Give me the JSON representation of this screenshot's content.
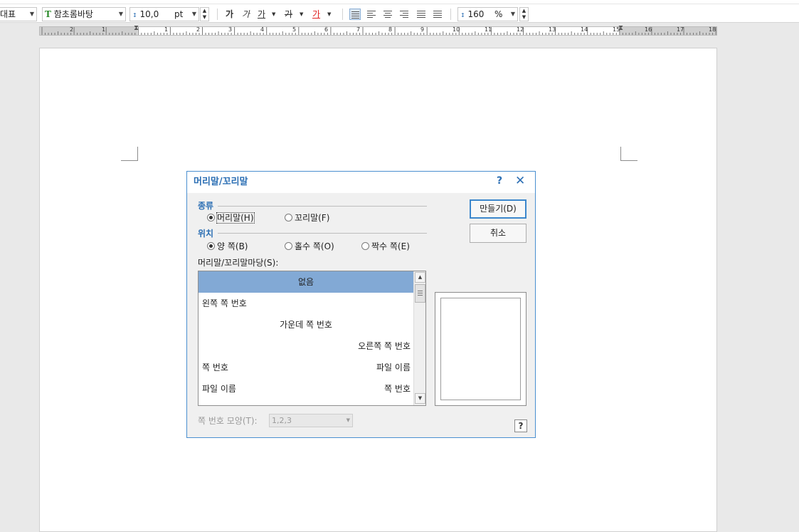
{
  "toolbar": {
    "style_value": "대표",
    "font_icon": "T",
    "font_value": "함초롬바탕",
    "size_value": "10,0",
    "size_unit": "pt",
    "bold_label": "가",
    "italic_label": "가",
    "underline_label": "가",
    "strike_label": "가",
    "color_label": "가",
    "line_spacing_value": "160",
    "line_spacing_unit": "%",
    "text_color": "#e02020",
    "icons": [
      "font-type-icon",
      "font-size-icon",
      "line-spacing-icon",
      "align-justify-icon",
      "align-left-icon",
      "align-center-icon",
      "align-right-icon",
      "distribute-icon",
      "divide-icon"
    ]
  },
  "ruler": {
    "numbers": [
      "2",
      "1",
      "1",
      "2",
      "3",
      "4",
      "5",
      "6",
      "7",
      "8",
      "9",
      "10",
      "11",
      "12",
      "13",
      "14",
      "15",
      "16",
      "17",
      "18"
    ]
  },
  "dialog": {
    "title": "머리말/꼬리말",
    "help_label": "?",
    "close_label": "✕",
    "type_group": {
      "label": "종류",
      "options": [
        "머리말(H)",
        "꼬리말(F)"
      ],
      "selected": 0
    },
    "position_group": {
      "label": "위치",
      "options": [
        "양 쪽(B)",
        "홀수 쪽(O)",
        "짝수 쪽(E)"
      ],
      "selected": 0
    },
    "templates_label": "머리말/꼬리말마당(S):",
    "templates": [
      {
        "left": "",
        "center": "없음",
        "right": ""
      },
      {
        "left": "왼쪽 쪽 번호",
        "center": "",
        "right": ""
      },
      {
        "left": "",
        "center": "가운데 쪽 번호",
        "right": ""
      },
      {
        "left": "",
        "center": "",
        "right": "오른쪽 쪽 번호"
      },
      {
        "left": "쪽 번호",
        "center": "",
        "right": "파일 이름"
      },
      {
        "left": "파일 이름",
        "center": "",
        "right": "쪽 번호"
      }
    ],
    "selected_template": 0,
    "create_button": "만들기(D)",
    "cancel_button": "취소",
    "page_number_format_label": "쪽 번호 모양(T):",
    "page_number_format_value": "1,2,3",
    "help_button": "?",
    "accent_color": "#2c6fb4",
    "selection_color": "#82a9d5"
  }
}
